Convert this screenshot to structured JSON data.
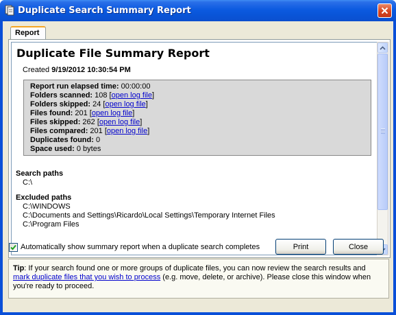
{
  "window": {
    "title": "Duplicate Search Summary Report"
  },
  "tabs": [
    {
      "label": "Report",
      "active": true
    }
  ],
  "report": {
    "title": "Duplicate File Summary Report",
    "created_label": "Created",
    "created_value": "9/19/2012 10:30:54 PM",
    "stats": [
      {
        "label": "Report run elapsed time:",
        "value": "00:00:00",
        "link": ""
      },
      {
        "label": "Folders scanned:",
        "value": "108",
        "link": "open log file"
      },
      {
        "label": "Folders skipped:",
        "value": "24",
        "link": "open log file"
      },
      {
        "label": "Files found:",
        "value": "201",
        "link": "open log file"
      },
      {
        "label": "Files skipped:",
        "value": "262",
        "link": "open log file"
      },
      {
        "label": "Files compared:",
        "value": "201",
        "link": "open log file"
      },
      {
        "label": "Duplicates found:",
        "value": "0",
        "link": ""
      },
      {
        "label": "Space used:",
        "value": "0 bytes",
        "link": ""
      }
    ],
    "search_paths": {
      "title": "Search paths",
      "items": [
        "C:\\"
      ]
    },
    "excluded_paths": {
      "title": "Excluded paths",
      "items": [
        "C:\\WINDOWS",
        "C:\\Documents and Settings\\Ricardo\\Local Settings\\Temporary Internet Files",
        "C:\\Program Files"
      ]
    }
  },
  "controls": {
    "auto_show_label": "Automatically show summary report when a duplicate search completes",
    "auto_show_checked": true,
    "print_label": "Print",
    "close_label": "Close"
  },
  "tip": {
    "label": "Tip",
    "text_before": ": If your search found one or more groups of duplicate files, you can now review the search results and ",
    "link_text": "mark duplicate files that you wish to process",
    "text_after": " (e.g. move, delete, or archive). Please close this window when you're ready to proceed."
  },
  "colors": {
    "titlebar": "#0a55d8",
    "stats_box": "#d9d9d9",
    "link": "#0000cc",
    "client": "#ece9d8"
  }
}
